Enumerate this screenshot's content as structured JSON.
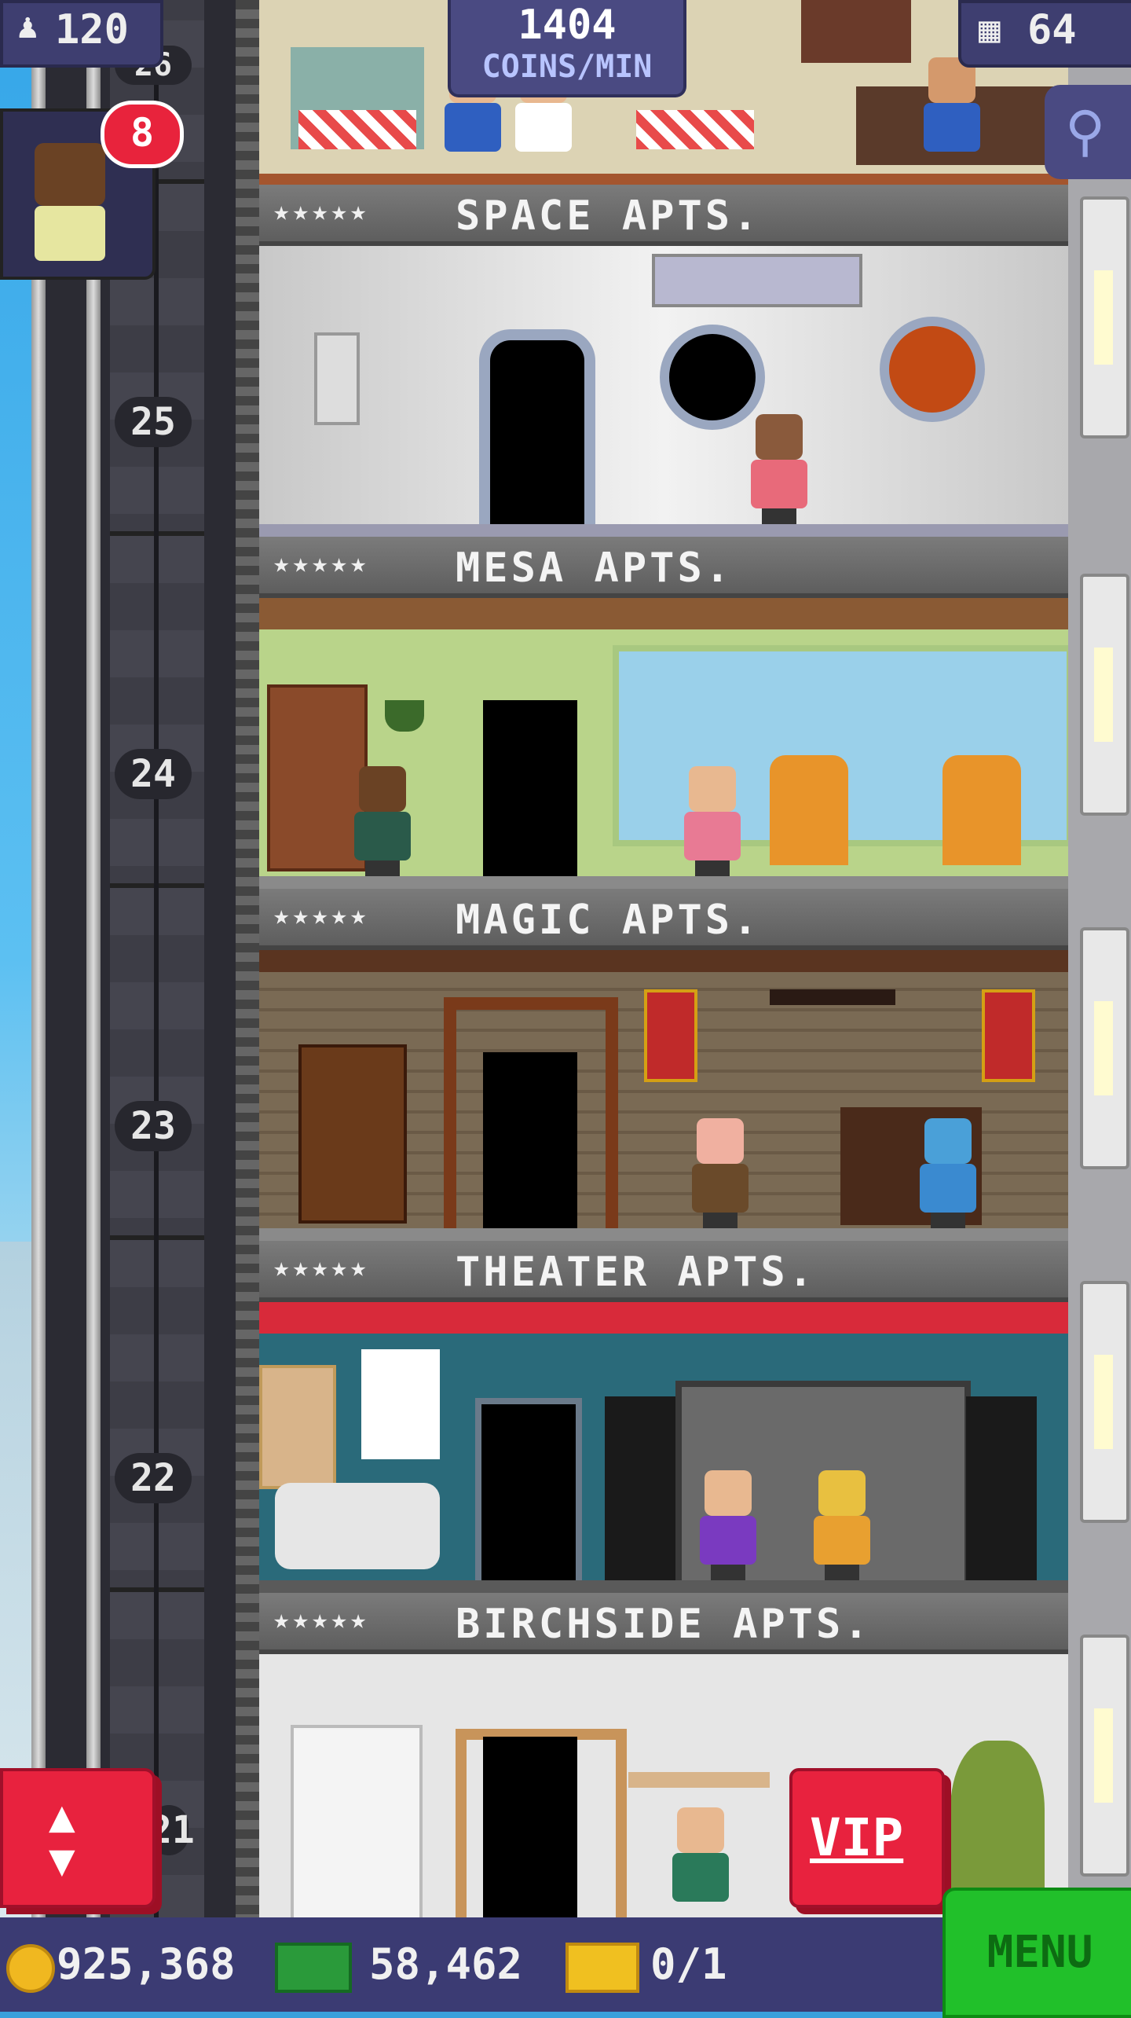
{
  "hud": {
    "population": "120",
    "coins_per_min_value": "1404",
    "coins_per_min_label": "COINS/MIN",
    "floors": "64",
    "notification_badge": "8"
  },
  "floors": [
    {
      "stars": "★★★★★",
      "name": "SPACE APTS.",
      "number": "25"
    },
    {
      "stars": "★★★★★",
      "name": "MESA APTS.",
      "number": "24"
    },
    {
      "stars": "★★★★★",
      "name": "MAGIC APTS.",
      "number": "23"
    },
    {
      "stars": "★★★★★",
      "name": "THEATER APTS.",
      "number": "22"
    },
    {
      "stars": "★★★★★",
      "name": "BIRCHSIDE APTS.",
      "number": "21"
    }
  ],
  "top_floor_number": "26",
  "buttons": {
    "vip": "VIP",
    "menu": "MENU",
    "elevator_arrows": "▲▼"
  },
  "bottom_bar": {
    "coins": "925,368",
    "bux": "58,462",
    "tickets": "0/1"
  },
  "colors": {
    "accent_red": "#e8223e",
    "menu_green": "#21c02a",
    "hud_blue": "#3e3e70"
  }
}
